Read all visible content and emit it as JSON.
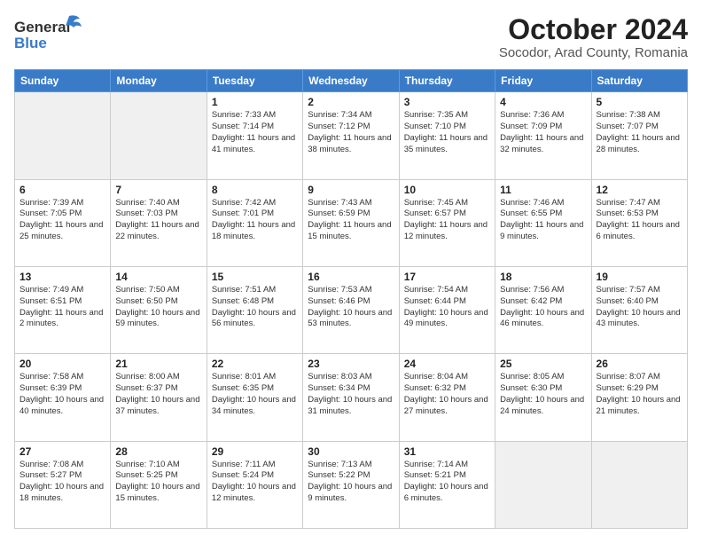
{
  "header": {
    "logo_general": "General",
    "logo_blue": "Blue",
    "month_title": "October 2024",
    "subtitle": "Socodor, Arad County, Romania"
  },
  "weekdays": [
    "Sunday",
    "Monday",
    "Tuesday",
    "Wednesday",
    "Thursday",
    "Friday",
    "Saturday"
  ],
  "weeks": [
    [
      {
        "day": "",
        "info": "",
        "empty": true
      },
      {
        "day": "",
        "info": "",
        "empty": true
      },
      {
        "day": "1",
        "info": "Sunrise: 7:33 AM\nSunset: 7:14 PM\nDaylight: 11 hours and 41 minutes.",
        "empty": false
      },
      {
        "day": "2",
        "info": "Sunrise: 7:34 AM\nSunset: 7:12 PM\nDaylight: 11 hours and 38 minutes.",
        "empty": false
      },
      {
        "day": "3",
        "info": "Sunrise: 7:35 AM\nSunset: 7:10 PM\nDaylight: 11 hours and 35 minutes.",
        "empty": false
      },
      {
        "day": "4",
        "info": "Sunrise: 7:36 AM\nSunset: 7:09 PM\nDaylight: 11 hours and 32 minutes.",
        "empty": false
      },
      {
        "day": "5",
        "info": "Sunrise: 7:38 AM\nSunset: 7:07 PM\nDaylight: 11 hours and 28 minutes.",
        "empty": false
      }
    ],
    [
      {
        "day": "6",
        "info": "Sunrise: 7:39 AM\nSunset: 7:05 PM\nDaylight: 11 hours and 25 minutes.",
        "empty": false
      },
      {
        "day": "7",
        "info": "Sunrise: 7:40 AM\nSunset: 7:03 PM\nDaylight: 11 hours and 22 minutes.",
        "empty": false
      },
      {
        "day": "8",
        "info": "Sunrise: 7:42 AM\nSunset: 7:01 PM\nDaylight: 11 hours and 18 minutes.",
        "empty": false
      },
      {
        "day": "9",
        "info": "Sunrise: 7:43 AM\nSunset: 6:59 PM\nDaylight: 11 hours and 15 minutes.",
        "empty": false
      },
      {
        "day": "10",
        "info": "Sunrise: 7:45 AM\nSunset: 6:57 PM\nDaylight: 11 hours and 12 minutes.",
        "empty": false
      },
      {
        "day": "11",
        "info": "Sunrise: 7:46 AM\nSunset: 6:55 PM\nDaylight: 11 hours and 9 minutes.",
        "empty": false
      },
      {
        "day": "12",
        "info": "Sunrise: 7:47 AM\nSunset: 6:53 PM\nDaylight: 11 hours and 6 minutes.",
        "empty": false
      }
    ],
    [
      {
        "day": "13",
        "info": "Sunrise: 7:49 AM\nSunset: 6:51 PM\nDaylight: 11 hours and 2 minutes.",
        "empty": false
      },
      {
        "day": "14",
        "info": "Sunrise: 7:50 AM\nSunset: 6:50 PM\nDaylight: 10 hours and 59 minutes.",
        "empty": false
      },
      {
        "day": "15",
        "info": "Sunrise: 7:51 AM\nSunset: 6:48 PM\nDaylight: 10 hours and 56 minutes.",
        "empty": false
      },
      {
        "day": "16",
        "info": "Sunrise: 7:53 AM\nSunset: 6:46 PM\nDaylight: 10 hours and 53 minutes.",
        "empty": false
      },
      {
        "day": "17",
        "info": "Sunrise: 7:54 AM\nSunset: 6:44 PM\nDaylight: 10 hours and 49 minutes.",
        "empty": false
      },
      {
        "day": "18",
        "info": "Sunrise: 7:56 AM\nSunset: 6:42 PM\nDaylight: 10 hours and 46 minutes.",
        "empty": false
      },
      {
        "day": "19",
        "info": "Sunrise: 7:57 AM\nSunset: 6:40 PM\nDaylight: 10 hours and 43 minutes.",
        "empty": false
      }
    ],
    [
      {
        "day": "20",
        "info": "Sunrise: 7:58 AM\nSunset: 6:39 PM\nDaylight: 10 hours and 40 minutes.",
        "empty": false
      },
      {
        "day": "21",
        "info": "Sunrise: 8:00 AM\nSunset: 6:37 PM\nDaylight: 10 hours and 37 minutes.",
        "empty": false
      },
      {
        "day": "22",
        "info": "Sunrise: 8:01 AM\nSunset: 6:35 PM\nDaylight: 10 hours and 34 minutes.",
        "empty": false
      },
      {
        "day": "23",
        "info": "Sunrise: 8:03 AM\nSunset: 6:34 PM\nDaylight: 10 hours and 31 minutes.",
        "empty": false
      },
      {
        "day": "24",
        "info": "Sunrise: 8:04 AM\nSunset: 6:32 PM\nDaylight: 10 hours and 27 minutes.",
        "empty": false
      },
      {
        "day": "25",
        "info": "Sunrise: 8:05 AM\nSunset: 6:30 PM\nDaylight: 10 hours and 24 minutes.",
        "empty": false
      },
      {
        "day": "26",
        "info": "Sunrise: 8:07 AM\nSunset: 6:29 PM\nDaylight: 10 hours and 21 minutes.",
        "empty": false
      }
    ],
    [
      {
        "day": "27",
        "info": "Sunrise: 7:08 AM\nSunset: 5:27 PM\nDaylight: 10 hours and 18 minutes.",
        "empty": false
      },
      {
        "day": "28",
        "info": "Sunrise: 7:10 AM\nSunset: 5:25 PM\nDaylight: 10 hours and 15 minutes.",
        "empty": false
      },
      {
        "day": "29",
        "info": "Sunrise: 7:11 AM\nSunset: 5:24 PM\nDaylight: 10 hours and 12 minutes.",
        "empty": false
      },
      {
        "day": "30",
        "info": "Sunrise: 7:13 AM\nSunset: 5:22 PM\nDaylight: 10 hours and 9 minutes.",
        "empty": false
      },
      {
        "day": "31",
        "info": "Sunrise: 7:14 AM\nSunset: 5:21 PM\nDaylight: 10 hours and 6 minutes.",
        "empty": false
      },
      {
        "day": "",
        "info": "",
        "empty": true
      },
      {
        "day": "",
        "info": "",
        "empty": true
      }
    ]
  ]
}
